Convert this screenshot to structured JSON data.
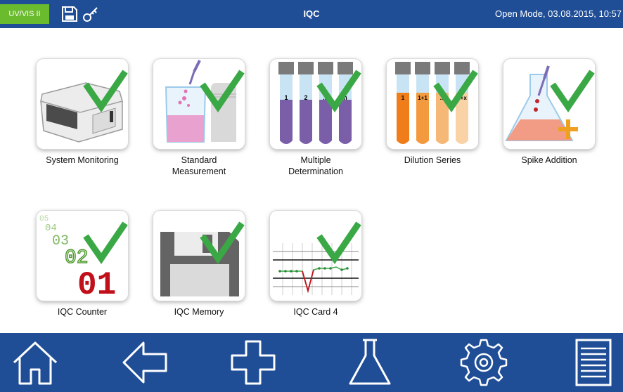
{
  "header": {
    "mode": "UV/VIS II",
    "title": "IQC",
    "status": "Open Mode, 03.08.2015, 10:57"
  },
  "tiles": [
    {
      "label": "System Monitoring",
      "icon": "photometer-icon"
    },
    {
      "label": "Standard\nMeasurement",
      "icon": "beaker-pipette-icon"
    },
    {
      "label": "Multiple\nDetermination",
      "icon": "test-tubes-icon",
      "tube_labels": [
        "1",
        "2",
        "...",
        "n"
      ]
    },
    {
      "label": "Dilution Series",
      "icon": "dilution-tubes-icon",
      "tube_labels": [
        "1",
        "1+1",
        "...",
        "1+x"
      ]
    },
    {
      "label": "Spike Addition",
      "icon": "flask-spike-icon"
    },
    {
      "label": "IQC Counter",
      "icon": "counter-digits-icon",
      "digits": [
        "05",
        "04",
        "03",
        "02",
        "01"
      ]
    },
    {
      "label": "IQC Memory",
      "icon": "floppy-disk-icon"
    },
    {
      "label": "IQC Card 4",
      "icon": "control-chart-icon"
    }
  ],
  "nav": [
    "home-icon",
    "back-arrow-icon",
    "add-plus-icon",
    "flask-icon",
    "settings-gear-icon",
    "menu-list-icon"
  ],
  "colors": {
    "header_blue": "#1f4e96",
    "badge_green": "#6bbb2f",
    "check_green": "#3aa845",
    "tube_purple": "#7a5ea8",
    "tube_orange": "#ef7d1a"
  }
}
